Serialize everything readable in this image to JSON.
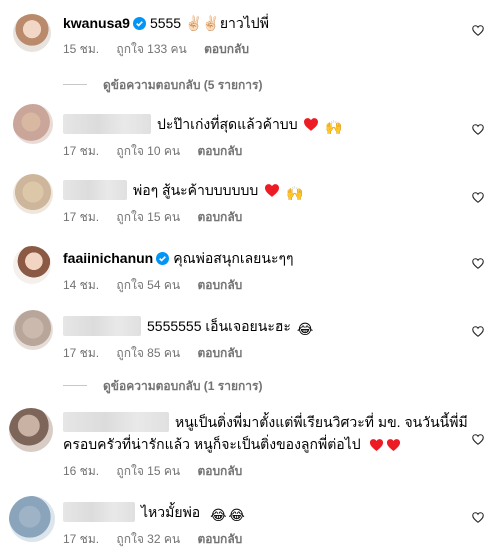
{
  "comments": [
    {
      "username": "kwanusa9",
      "verified": true,
      "text": "5555 ✌🏻✌🏻ยาวไปพี่",
      "time": "15 ชม.",
      "likes": "ถูกใจ 133 คน",
      "reply": "ตอบกลับ",
      "avatar_icon": "profile-photo"
    },
    {
      "username": "",
      "text": "ปะป๊าเก่งที่สุดแล้วค้าบบ",
      "time": "17 ชม.",
      "likes": "ถูกใจ 10 คน",
      "reply": "ตอบกลับ"
    },
    {
      "username": "",
      "text": "พ่อๆ สู้นะค้าบบบบบบ",
      "time": "17 ชม.",
      "likes": "ถูกใจ 15 คน",
      "reply": "ตอบกลับ"
    },
    {
      "username": "faaiinichanun",
      "verified": true,
      "text": "คุณพ่อสนุกเลยนะๆๆ",
      "time": "14 ชม.",
      "likes": "ถูกใจ 54 คน",
      "reply": "ตอบกลับ"
    },
    {
      "username": "",
      "text": "5555555 เอ็นเจอยนะฮะ",
      "time": "17 ชม.",
      "likes": "ถูกใจ 85 คน",
      "reply": "ตอบกลับ"
    },
    {
      "username": "",
      "text_line1": "หนูเป็นติ่งพี่มาตั้งแต่พี่เรียนวิศวะที่ มข. จนวันนี้พี่มี",
      "text_line2": "ครอบครัวที่น่ารักแล้ว หนูก็จะเป็นติ่งของลูกพี่ต่อไป",
      "time": "16 ชม.",
      "likes": "ถูกใจ 15 คน",
      "reply": "ตอบกลับ"
    },
    {
      "username": "",
      "text": "ไหวมั้ยพ่อ",
      "time": "17 ชม.",
      "likes": "ถูกใจ 32 คน",
      "reply": "ตอบกลับ"
    }
  ],
  "threads": [
    {
      "label": "ดูข้อความตอบกลับ (5 รายการ)"
    },
    {
      "label": "ดูข้อความตอบกลับ (1 รายการ)"
    }
  ],
  "colors": {
    "verified": "#0095f6",
    "meta": "#737373",
    "heart_red": "#ed1c24"
  }
}
